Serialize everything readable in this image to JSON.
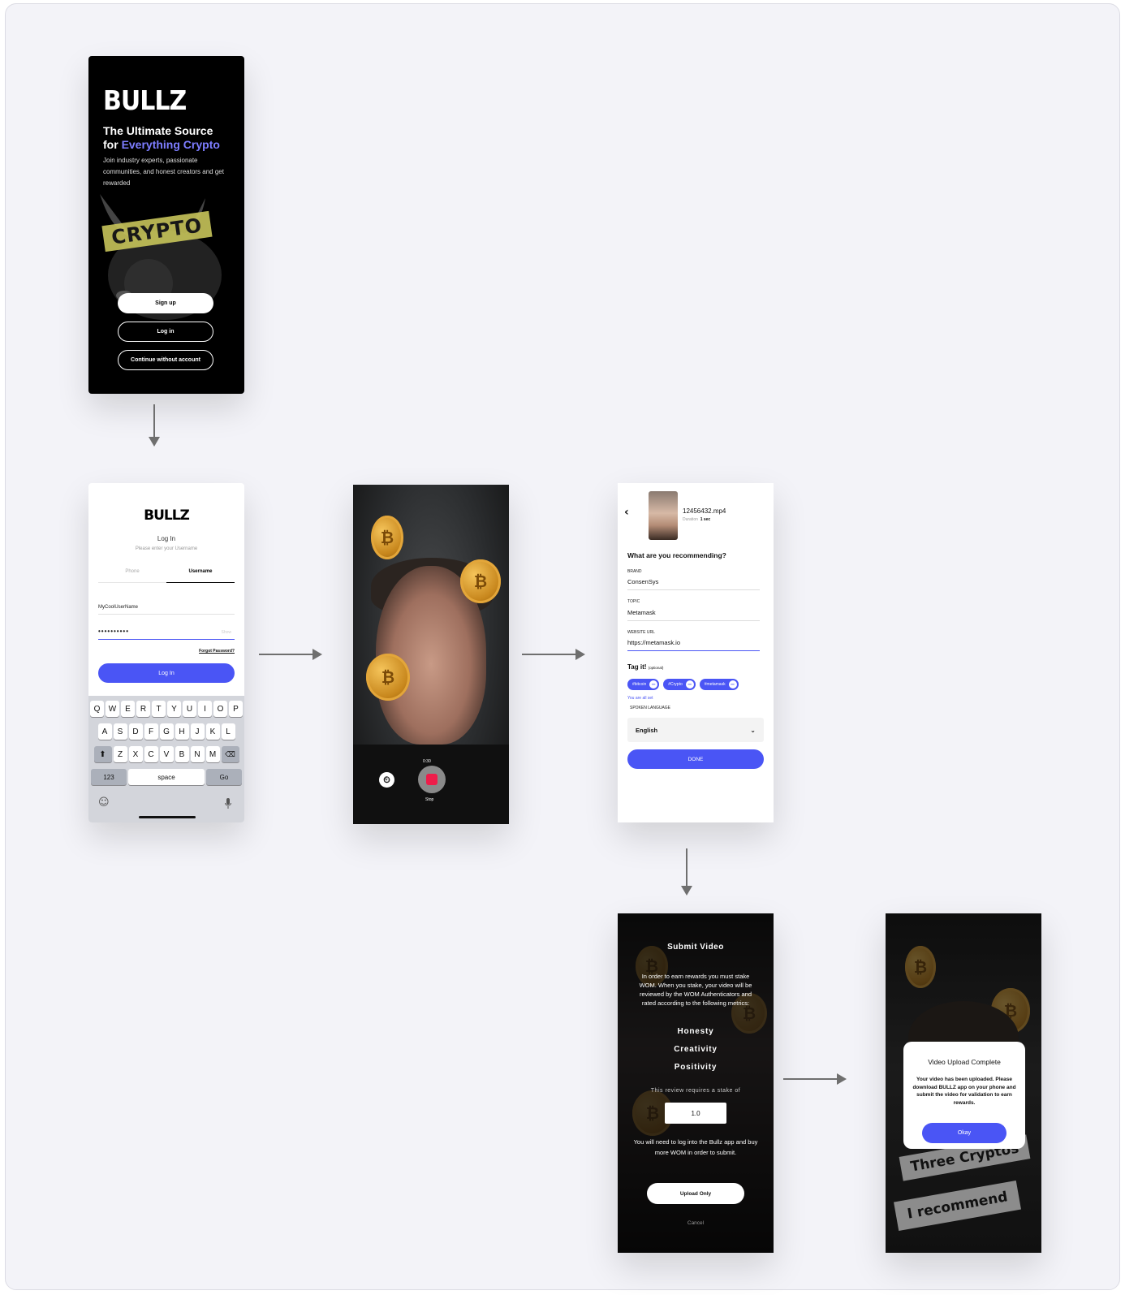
{
  "welcome": {
    "logo": "BULLZ",
    "headline_line1": "The Ultimate Source",
    "headline_for": "for ",
    "headline_accent": "Everything Crypto",
    "subtitle": "Join industry experts, passionate communities, and honest creators and get rewarded",
    "banner": "CRYPTO",
    "signup_label": "Sign up",
    "login_label": "Log in",
    "guest_label": "Continue without account"
  },
  "login": {
    "logo": "BULLZ",
    "title": "Log In",
    "hint": "Please enter your Username",
    "tab_phone": "Phone",
    "tab_username": "Username",
    "username_value": "MyCoolUserName",
    "password_value": "••••••••••",
    "show_label": "Show",
    "forgot_label": "Forgot Password?",
    "login_button": "Log In",
    "keyboard": {
      "row1": [
        "Q",
        "W",
        "E",
        "R",
        "T",
        "Y",
        "U",
        "I",
        "O",
        "P"
      ],
      "row2": [
        "A",
        "S",
        "D",
        "F",
        "G",
        "H",
        "J",
        "K",
        "L"
      ],
      "row3": [
        "Z",
        "X",
        "C",
        "V",
        "B",
        "N",
        "M"
      ],
      "numbers_key": "123",
      "space_key": "space",
      "go_key": "Go"
    }
  },
  "record": {
    "time": "0:30",
    "stop_label": "Stop"
  },
  "details": {
    "file_name": "12456432.mp4",
    "duration_label": "Duration",
    "duration_value": "1 sec",
    "question": "What are you recommending?",
    "brand_label": "BRAND",
    "brand_value": "ConsenSys",
    "topic_label": "TOPIC",
    "topic_value": "Metamask",
    "url_label": "WEBSITE URL",
    "url_value": "https://metamask.io",
    "tag_label": "Tag it!",
    "tag_optional": "(optional)",
    "tags": [
      "#bitcoin",
      "#Crypto",
      "#metamask"
    ],
    "all_set": "You are all set",
    "language_label": "SPOKEN LANGUAGE",
    "language_value": "English",
    "done_label": "DONE"
  },
  "submit": {
    "title": "Submit Video",
    "description": "In order to earn rewards you must stake WOM. When you stake, your video will be reviewed by the WOM Authenticators and rated according to the following metrics:",
    "metrics": [
      "Honesty",
      "Creativity",
      "Positivity"
    ],
    "stake_text": "This review requires a stake of",
    "stake_value": "1.0",
    "note": "You will need to log into the Bullz app and buy more WOM in order to submit.",
    "upload_label": "Upload Only",
    "cancel_label": "Cancel"
  },
  "complete": {
    "strip1": "Three Cryptos",
    "strip2": "I recommend",
    "modal_title": "Video Upload Complete",
    "modal_body": "Your video has been uploaded. Please download BULLZ app on your phone and submit the video for validation to earn rewards.",
    "ok_label": "Okay"
  },
  "colors": {
    "accent": "#4a55f5",
    "headline_accent": "#7d7dff",
    "record": "#ee1d4a",
    "board": "#f3f3f8"
  }
}
